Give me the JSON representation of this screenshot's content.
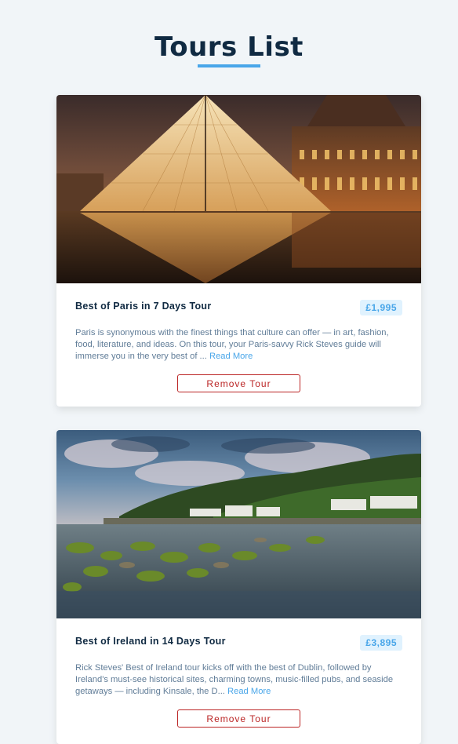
{
  "page": {
    "title": "Tours List",
    "accent_color": "#49a6e9",
    "remove_color": "#bb2525"
  },
  "tours": [
    {
      "name": "Best of Paris in 7 Days Tour",
      "price": "£1,995",
      "description": "Paris is synonymous with the finest things that culture can offer — in art, fashion, food, literature, and ideas. On this tour, your Paris-savvy Rick Steves guide will immerse you in the very best of ...",
      "read_more": "Read More",
      "remove_label": "Remove Tour",
      "image_subject": "Louvre glass pyramid at night"
    },
    {
      "name": "Best of Ireland in 14 Days Tour",
      "price": "£3,895",
      "description": "Rick Steves' Best of Ireland tour kicks off with the best of Dublin, followed by Ireland's must-see historical sites, charming towns, music-filled pubs, and seaside getaways — including Kinsale, the D...",
      "read_more": "Read More",
      "remove_label": "Remove Tour",
      "image_subject": "Irish coastal village with mossy rocks"
    }
  ]
}
